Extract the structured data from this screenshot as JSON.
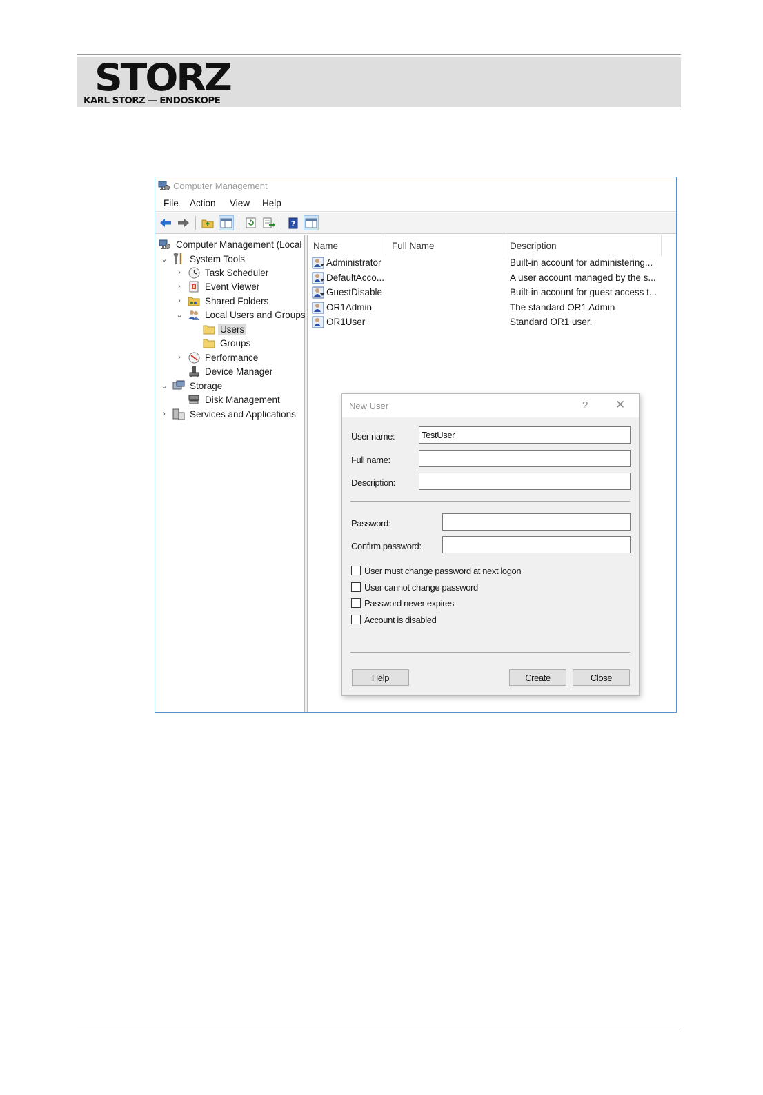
{
  "brand": {
    "logo_main": "STORZ",
    "logo_sub": "KARL STORZ — ENDOSKOPE"
  },
  "window": {
    "title": "Computer Management",
    "menu": [
      "File",
      "Action",
      "View",
      "Help"
    ]
  },
  "tree": {
    "root": "Computer Management (Local",
    "system_tools": "System Tools",
    "task_scheduler": "Task Scheduler",
    "event_viewer": "Event Viewer",
    "shared_folders": "Shared Folders",
    "local_users_groups": "Local Users and Groups",
    "users": "Users",
    "groups": "Groups",
    "performance": "Performance",
    "device_manager": "Device Manager",
    "storage": "Storage",
    "disk_management": "Disk Management",
    "services_apps": "Services and Applications"
  },
  "list": {
    "columns": [
      "Name",
      "Full Name",
      "Description"
    ],
    "rows": [
      {
        "name": "Administrator",
        "full_name": "",
        "description": "Built-in account for administering..."
      },
      {
        "name": "DefaultAcco...",
        "full_name": "",
        "description": "A user account managed by the s..."
      },
      {
        "name": "GuestDisable",
        "full_name": "",
        "description": "Built-in account for guest access t..."
      },
      {
        "name": "OR1Admin",
        "full_name": "",
        "description": "The standard OR1 Admin"
      },
      {
        "name": "OR1User",
        "full_name": "",
        "description": "Standard OR1 user."
      }
    ]
  },
  "dialog": {
    "title": "New User",
    "help_glyph": "?",
    "close_glyph": "✕",
    "user_name_label": "User name:",
    "user_name_value": "TestUser",
    "full_name_label": "Full name:",
    "full_name_value": "",
    "description_label": "Description:",
    "description_value": "",
    "password_label": "Password:",
    "password_value": "",
    "confirm_label": "Confirm password:",
    "confirm_value": "",
    "checkboxes": [
      {
        "label": "User must change password at next logon",
        "checked": false
      },
      {
        "label": "User cannot change password",
        "checked": false
      },
      {
        "label": "Password never expires",
        "checked": false
      },
      {
        "label": "Account is disabled",
        "checked": false
      }
    ],
    "help_button": "Help",
    "create_button": "Create",
    "close_button": "Close"
  },
  "colors": {
    "window_border": "#5b8fd0",
    "dialog_bg": "#f0f0f0",
    "header_band": "#dedede"
  }
}
